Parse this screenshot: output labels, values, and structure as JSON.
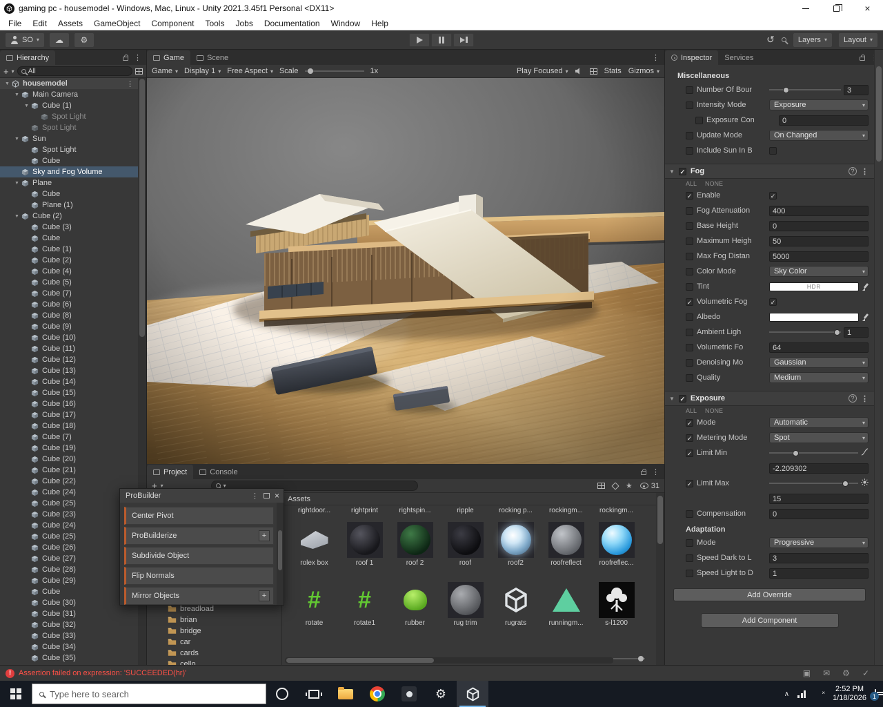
{
  "window": {
    "title": "gaming pc - housemodel - Windows, Mac, Linux - Unity 2021.3.45f1 Personal <DX11>",
    "menus": [
      "File",
      "Edit",
      "Assets",
      "GameObject",
      "Component",
      "Tools",
      "Jobs",
      "Documentation",
      "Window",
      "Help"
    ]
  },
  "toolbar": {
    "account": "SO",
    "layers": "Layers",
    "layout": "Layout"
  },
  "hierarchy": {
    "tab": "Hierarchy",
    "search": "All",
    "items": [
      {
        "label": "housemodel",
        "indent": 0,
        "icon": "unity",
        "arrow": true,
        "scene": true
      },
      {
        "label": "Main Camera",
        "indent": 1,
        "arrow": true
      },
      {
        "label": "Cube (1)",
        "indent": 2,
        "arrow": true
      },
      {
        "label": "Spot Light",
        "indent": 3,
        "dim": true
      },
      {
        "label": "Spot Light",
        "indent": 2,
        "dim": true
      },
      {
        "label": "Sun",
        "indent": 1,
        "arrow": true
      },
      {
        "label": "Spot Light",
        "indent": 2
      },
      {
        "label": "Cube",
        "indent": 2
      },
      {
        "label": "Sky and Fog Volume",
        "indent": 1,
        "selected": true
      },
      {
        "label": "Plane",
        "indent": 1,
        "arrow": true
      },
      {
        "label": "Cube",
        "indent": 2
      },
      {
        "label": "Plane (1)",
        "indent": 2
      },
      {
        "label": "Cube (2)",
        "indent": 1,
        "arrow": true
      },
      {
        "label": "Cube (3)",
        "indent": 2
      },
      {
        "label": "Cube",
        "indent": 2
      },
      {
        "label": "Cube (1)",
        "indent": 2
      },
      {
        "label": "Cube (2)",
        "indent": 2
      },
      {
        "label": "Cube (4)",
        "indent": 2
      },
      {
        "label": "Cube (5)",
        "indent": 2
      },
      {
        "label": "Cube (7)",
        "indent": 2
      },
      {
        "label": "Cube (6)",
        "indent": 2
      },
      {
        "label": "Cube (8)",
        "indent": 2
      },
      {
        "label": "Cube (9)",
        "indent": 2
      },
      {
        "label": "Cube (10)",
        "indent": 2
      },
      {
        "label": "Cube (11)",
        "indent": 2
      },
      {
        "label": "Cube (12)",
        "indent": 2
      },
      {
        "label": "Cube (13)",
        "indent": 2
      },
      {
        "label": "Cube (14)",
        "indent": 2
      },
      {
        "label": "Cube (15)",
        "indent": 2
      },
      {
        "label": "Cube (16)",
        "indent": 2
      },
      {
        "label": "Cube (17)",
        "indent": 2
      },
      {
        "label": "Cube (18)",
        "indent": 2
      },
      {
        "label": "Cube (7)",
        "indent": 2
      },
      {
        "label": "Cube (19)",
        "indent": 2
      },
      {
        "label": "Cube (20)",
        "indent": 2
      },
      {
        "label": "Cube (21)",
        "indent": 2
      },
      {
        "label": "Cube (22)",
        "indent": 2
      },
      {
        "label": "Cube (24)",
        "indent": 2
      },
      {
        "label": "Cube (25)",
        "indent": 2
      },
      {
        "label": "Cube (23)",
        "indent": 2
      },
      {
        "label": "Cube (24)",
        "indent": 2
      },
      {
        "label": "Cube (25)",
        "indent": 2
      },
      {
        "label": "Cube (26)",
        "indent": 2
      },
      {
        "label": "Cube (27)",
        "indent": 2
      },
      {
        "label": "Cube (28)",
        "indent": 2
      },
      {
        "label": "Cube (29)",
        "indent": 2
      },
      {
        "label": "Cube",
        "indent": 2
      },
      {
        "label": "Cube (30)",
        "indent": 2
      },
      {
        "label": "Cube (31)",
        "indent": 2
      },
      {
        "label": "Cube (32)",
        "indent": 2
      },
      {
        "label": "Cube (33)",
        "indent": 2
      },
      {
        "label": "Cube (34)",
        "indent": 2
      },
      {
        "label": "Cube (35)",
        "indent": 2
      }
    ]
  },
  "game_view": {
    "tab_game": "Game",
    "tab_scene": "Scene",
    "menu": "Game",
    "display": "Display 1",
    "aspect": "Free Aspect",
    "scale_label": "Scale",
    "scale_value": "1x",
    "focus": "Play Focused",
    "stats": "Stats",
    "gizmos": "Gizmos"
  },
  "project": {
    "tab_project": "Project",
    "tab_console": "Console",
    "hidden_count": "31",
    "assets_title": "Assets",
    "folders": [
      "breadload",
      "brian",
      "bridge",
      "car",
      "cards",
      "cello"
    ],
    "partial_labels": [
      "rightdoor...",
      "rightprint",
      "rightspin...",
      "ripple",
      "rocking p...",
      "rockingm...",
      "rockingm..."
    ],
    "tiles": [
      {
        "label": "rolex box",
        "kind": "mesh"
      },
      {
        "label": "roof 1",
        "kind": "sphere_dark"
      },
      {
        "label": "roof 2",
        "kind": "sphere_green"
      },
      {
        "label": "roof",
        "kind": "sphere_black"
      },
      {
        "label": "roof2",
        "kind": "sphere_glow"
      },
      {
        "label": "roofreflect",
        "kind": "sphere_gray"
      },
      {
        "label": "roofreflec...",
        "kind": "sphere_blue"
      },
      {
        "label": "rotate",
        "kind": "script"
      },
      {
        "label": "rotate1",
        "kind": "script"
      },
      {
        "label": "rubber",
        "kind": "physic"
      },
      {
        "label": "rug trim",
        "kind": "sphere_gray2"
      },
      {
        "label": "rugrats",
        "kind": "unity"
      },
      {
        "label": "runningm...",
        "kind": "triangle"
      },
      {
        "label": "s-l1200",
        "kind": "photo"
      }
    ]
  },
  "probuilder": {
    "title": "ProBuilder",
    "items": [
      {
        "label": "Center Pivot"
      },
      {
        "label": "ProBuilderize",
        "plus": true
      },
      {
        "label": "Subdivide Object"
      },
      {
        "label": "Flip Normals"
      },
      {
        "label": "Mirror Objects",
        "plus": true
      }
    ]
  },
  "inspector": {
    "tab_inspector": "Inspector",
    "tab_services": "Services",
    "all_label": "ALL",
    "none_label": "NONE",
    "sections": [
      {
        "kind": "plain",
        "title": "Miscellaneous",
        "rows": [
          {
            "label": "Number Of Bour",
            "ctl": "sliderfield",
            "value": "3",
            "pct": 24
          },
          {
            "label": "Intensity Mode",
            "ctl": "dropdown",
            "value": "Exposure"
          },
          {
            "label": "Exposure Con",
            "ctl": "field",
            "value": "0",
            "indent": 1
          },
          {
            "label": "Update Mode",
            "ctl": "dropdown",
            "value": "On Changed"
          },
          {
            "label": "Include Sun In B",
            "ctl": "check",
            "on": false
          }
        ]
      },
      {
        "kind": "volume",
        "title": "Fog",
        "rows": [
          {
            "label": "Enable",
            "chk": true,
            "ctl": "check",
            "on": true
          },
          {
            "label": "Fog Attenuation",
            "ctl": "field",
            "value": "400"
          },
          {
            "label": "Base Height",
            "ctl": "field",
            "value": "0"
          },
          {
            "label": "Maximum Heigh",
            "ctl": "field",
            "value": "50"
          },
          {
            "label": "Max Fog Distan",
            "ctl": "field",
            "value": "5000"
          },
          {
            "label": "Color Mode",
            "ctl": "dropdown",
            "value": "Sky Color"
          },
          {
            "label": "Tint",
            "ctl": "colorhdr",
            "value": "HDR"
          },
          {
            "label": "Volumetric Fog",
            "chk": true,
            "ctl": "check",
            "on": true
          },
          {
            "label": "Albedo",
            "ctl": "color"
          },
          {
            "label": "Ambient Ligh",
            "ctl": "sliderfield",
            "value": "1",
            "pct": 95
          },
          {
            "label": "Volumetric Fo",
            "ctl": "field",
            "value": "64"
          },
          {
            "label": "Denoising Mo",
            "ctl": "dropdown",
            "value": "Gaussian"
          },
          {
            "label": "Quality",
            "ctl": "dropdown",
            "value": "Medium"
          }
        ]
      },
      {
        "kind": "volume",
        "title": "Exposure",
        "rows": [
          {
            "label": "Mode",
            "chk": true,
            "ctl": "dropdown",
            "value": "Automatic"
          },
          {
            "label": "Metering Mode",
            "chk": true,
            "ctl": "dropdown",
            "value": "Spot"
          },
          {
            "label": "Limit Min",
            "chk": true,
            "ctl": "sliderwide",
            "pct": 30,
            "tail": "curve"
          },
          {
            "label": "",
            "ctl": "fullfield",
            "value": "-2.209302"
          },
          {
            "label": "Limit Max",
            "chk": true,
            "ctl": "sliderwide",
            "pct": 86,
            "tail": "sun"
          },
          {
            "label": "",
            "ctl": "fullfield",
            "value": "15"
          },
          {
            "label": "Compensation",
            "ctl": "field",
            "value": "0"
          },
          {
            "label": "Adaptation",
            "ctl": "subheader"
          },
          {
            "label": "Mode",
            "ctl": "dropdown",
            "value": "Progressive"
          },
          {
            "label": "Speed Dark to L",
            "ctl": "field",
            "value": "3"
          },
          {
            "label": "Speed Light to D",
            "ctl": "field",
            "value": "1"
          }
        ]
      }
    ],
    "add_override": "Add Override",
    "add_component": "Add Component"
  },
  "status_bar": {
    "message": "Assertion failed on expression: 'SUCCEEDED(hr)'"
  },
  "taskbar": {
    "search_placeholder": "Type here to search",
    "time": "2:52 PM",
    "date": "1/18/2026",
    "badge": "1"
  }
}
